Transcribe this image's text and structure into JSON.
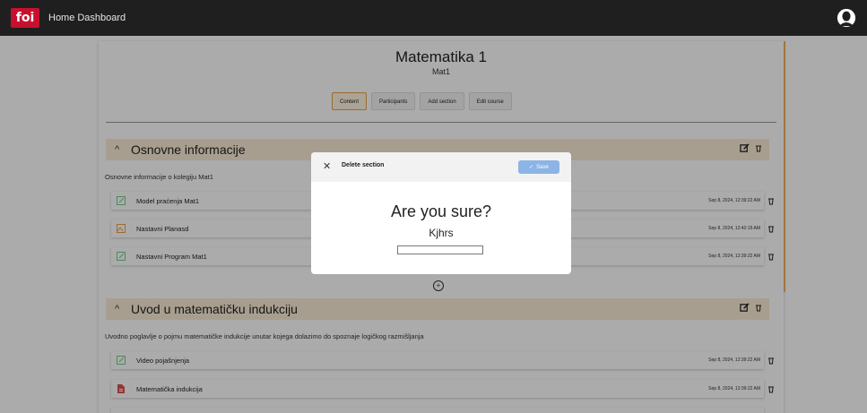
{
  "nav": {
    "logo": "foi",
    "links": [
      "Home",
      "Dashboard"
    ]
  },
  "course": {
    "title": "Matematika 1",
    "subtitle": "Mat1",
    "tabs": [
      {
        "label": "Content",
        "active": true
      },
      {
        "label": "Participants"
      },
      {
        "label": "Add section"
      },
      {
        "label": "Edit course"
      }
    ]
  },
  "sections": [
    {
      "title": "Osnovne informacije",
      "description": "Osnovne informacije o kolegiju Mat1",
      "items": [
        {
          "name": "Model praćenja Mat1",
          "date": "Sep 8, 2024, 12:39:22 AM",
          "icon": "edit-file-icon"
        },
        {
          "name": "Nastavni Planasd",
          "date": "Sep 8, 2024, 12:42:15 AM",
          "icon": "image-file-icon"
        },
        {
          "name": "Nastavni Program Mat1",
          "date": "Sep 8, 2024, 12:39:22 AM",
          "icon": "edit-file-icon"
        }
      ]
    },
    {
      "title": "Uvod u matematičku indukciju",
      "description": "Uvodno poglavlje o pojmu matematičke indukcije unutar kojega dolazimo do spoznaje logičkog razmišljanja",
      "items": [
        {
          "name": "Video pojašnjenja",
          "date": "Sep 8, 2024, 12:39:22 AM",
          "icon": "edit-file-icon"
        },
        {
          "name": "Matematička indukcija",
          "date": "Sep 8, 2024, 12:39:22 AM",
          "icon": "pdf-file-icon"
        }
      ]
    }
  ],
  "modal": {
    "title": "Delete section",
    "save_label": "Save",
    "question": "Are you sure?",
    "section_name": "Kjhrs",
    "input_value": ""
  },
  "colors": {
    "accent": "#e7a24a",
    "section_bg": "#fbecd6",
    "save_button": "#8cb4e6",
    "topbar": "#1f1f1f",
    "logo": "#c8102e"
  }
}
